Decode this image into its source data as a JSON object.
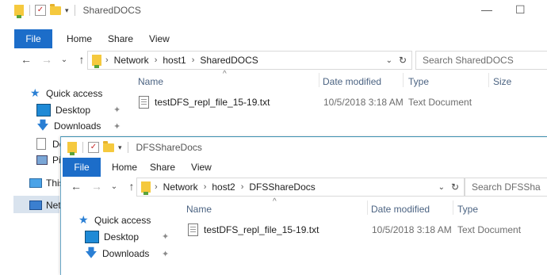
{
  "window1": {
    "title": "SharedDOCS",
    "tabs": [
      "File",
      "Home",
      "Share",
      "View"
    ],
    "breadcrumb": [
      "Network",
      "host1",
      "SharedDOCS"
    ],
    "search_placeholder": "Search SharedDOCS",
    "columns": [
      "Name",
      "Date modified",
      "Type",
      "Size"
    ],
    "files": [
      {
        "name": "testDFS_repl_file_15-19.txt",
        "date": "10/5/2018 3:18 AM",
        "type": "Text Document"
      }
    ],
    "nav": {
      "quick_access": "Quick access",
      "desktop": "Desktop",
      "downloads": "Downloads",
      "documents_partial": "Do",
      "pictures_partial": "Pic",
      "this_pc_partial": "This",
      "network_partial": "Netw"
    }
  },
  "window2": {
    "title": "DFSShareDocs",
    "tabs": [
      "File",
      "Home",
      "Share",
      "View"
    ],
    "breadcrumb": [
      "Network",
      "host2",
      "DFSShareDocs"
    ],
    "search_placeholder": "Search DFSSha",
    "columns": [
      "Name",
      "Date modified",
      "Type"
    ],
    "files": [
      {
        "name": "testDFS_repl_file_15-19.txt",
        "date": "10/5/2018 3:18 AM",
        "type": "Text Document"
      }
    ],
    "nav": {
      "quick_access": "Quick access",
      "desktop": "Desktop",
      "downloads": "Downloads"
    }
  },
  "colors": {
    "file_tab": "#1c6dc9",
    "header_text": "#4b6382",
    "selection": "#d9e3ee"
  }
}
